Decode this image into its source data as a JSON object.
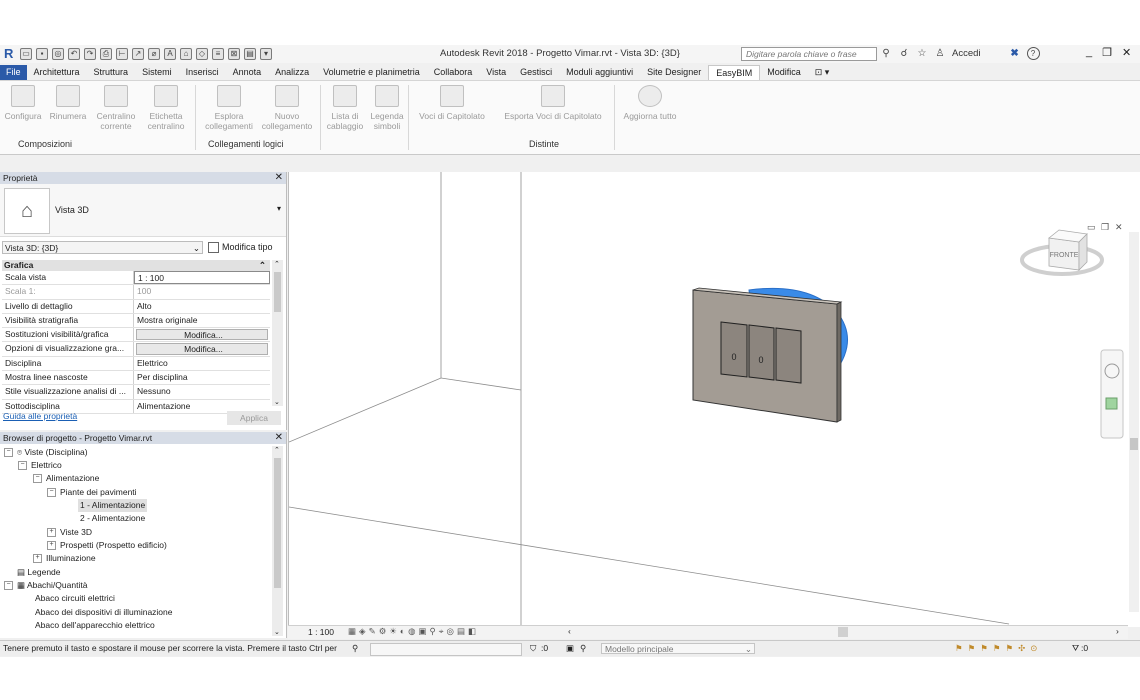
{
  "titlebar": {
    "logo": "R",
    "title": "Autodesk Revit 2018 -   Progetto Vimar.rvt - Vista 3D: {3D}",
    "search_placeholder": "Digitare parola chiave o frase",
    "signin": "Accedi",
    "help": "?",
    "win_minimize": "_",
    "win_restore": "❐",
    "win_close": "✕"
  },
  "tabs": [
    "File",
    "Architettura",
    "Struttura",
    "Sistemi",
    "Inserisci",
    "Annota",
    "Analizza",
    "Volumetrie e planimetria",
    "Collabora",
    "Vista",
    "Gestisci",
    "Moduli aggiuntivi",
    "Site Designer",
    "EasyBIM",
    "Modifica"
  ],
  "active_tab": "EasyBIM",
  "ribbon": {
    "buttons": [
      {
        "label": "Configura"
      },
      {
        "label": "Rinumera"
      },
      {
        "label": "Centralino\ncorrente"
      },
      {
        "label": "Etichetta\ncentralino"
      },
      {
        "label": "Esplora\ncollegamenti"
      },
      {
        "label": "Nuovo\ncollegamento"
      },
      {
        "label": "Lista di\ncablaggio"
      },
      {
        "label": "Legenda\nsimboli"
      },
      {
        "label": "Voci di Capitolato"
      },
      {
        "label": "Esporta Voci di Capitolato"
      },
      {
        "label": "Aggiorna tutto"
      }
    ],
    "groups": [
      "Composizioni",
      "Collegamenti logici",
      "Distinte"
    ]
  },
  "properties": {
    "title": "Proprietà",
    "type_name": "Vista 3D",
    "view_selector": "Vista 3D: {3D}",
    "edit_type": "Modifica tipo",
    "section": "Grafica",
    "rows": [
      {
        "k": "Scala vista",
        "v": "1 : 100"
      },
      {
        "k": "Scala  1:",
        "v": "100"
      },
      {
        "k": "Livello di dettaglio",
        "v": "Alto"
      },
      {
        "k": "Visibilità stratigrafia",
        "v": "Mostra originale"
      },
      {
        "k": "Sostituzioni visibilità/grafica",
        "v": "Modifica..."
      },
      {
        "k": "Opzioni di visualizzazione gra...",
        "v": "Modifica..."
      },
      {
        "k": "Disciplina",
        "v": "Elettrico"
      },
      {
        "k": "Mostra linee nascoste",
        "v": "Per disciplina"
      },
      {
        "k": "Stile visualizzazione analisi di ...",
        "v": "Nessuno"
      },
      {
        "k": "Sottodisciplina",
        "v": "Alimentazione"
      }
    ],
    "help_link": "Guida alle proprietà",
    "apply": "Applica"
  },
  "browser": {
    "title": "Browser di progetto - Progetto Vimar.rvt",
    "items": [
      {
        "label": "Viste (Disciplina)"
      },
      {
        "label": "Elettrico"
      },
      {
        "label": "Alimentazione"
      },
      {
        "label": "Piante dei pavimenti"
      },
      {
        "label": "1 - Alimentazione"
      },
      {
        "label": "2 - Alimentazione"
      },
      {
        "label": "Viste 3D"
      },
      {
        "label": "Prospetti (Prospetto edificio)"
      },
      {
        "label": "Illuminazione"
      },
      {
        "label": "Legende"
      },
      {
        "label": "Abachi/Quantità"
      },
      {
        "label": "Abaco circuiti elettrici"
      },
      {
        "label": "Abaco dei dispositivi di illuminazione"
      },
      {
        "label": "Abaco dell'apparecchio elettrico"
      }
    ]
  },
  "viewport": {
    "viewcube_face": "FRONTE",
    "scale": "1 : 100",
    "switch_labels": [
      "0",
      "0"
    ]
  },
  "status": {
    "message": "Tenere premuto il tasto e spostare il mouse per scorrere la vista. Premere il tasto Ctrl per",
    "count": ":0",
    "model": "Modello principale",
    "filter_count": ":0"
  },
  "colors": {
    "accent": "#2b5aa8",
    "body_blue": "#3a8be8",
    "plate": "#a39c94"
  }
}
